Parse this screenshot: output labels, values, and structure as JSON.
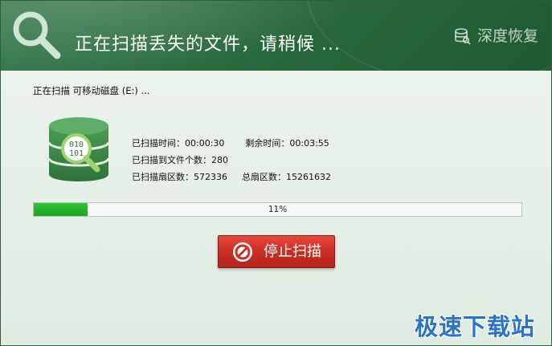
{
  "header": {
    "title": "正在扫描丢失的文件，请稍候 ...",
    "brand": "深度恢复",
    "header_icon": "magnifier-icon",
    "brand_icon": "database-icon"
  },
  "scan": {
    "target": "正在扫描  可移动磁盘 (E:) ...",
    "disk_icon": "database-scan-icon"
  },
  "stats": {
    "elapsed": "已扫描时间：00:00:30",
    "remaining": "剩余时间：00:03:55",
    "files_found": "已扫描到文件个数：280",
    "sectors_scanned": "已扫描扇区数：572336",
    "sectors_total": "总扇区数：15261632"
  },
  "progress": {
    "percent": 11,
    "label": "11%"
  },
  "stop_button": {
    "label": "停止扫描",
    "icon": "stop-icon"
  },
  "watermark": "极速下载站",
  "colors": {
    "header_green": "#2a6a3d",
    "progress_green": "#17a51d",
    "button_red": "#cc2e24",
    "watermark_blue": "#2a73c9"
  }
}
